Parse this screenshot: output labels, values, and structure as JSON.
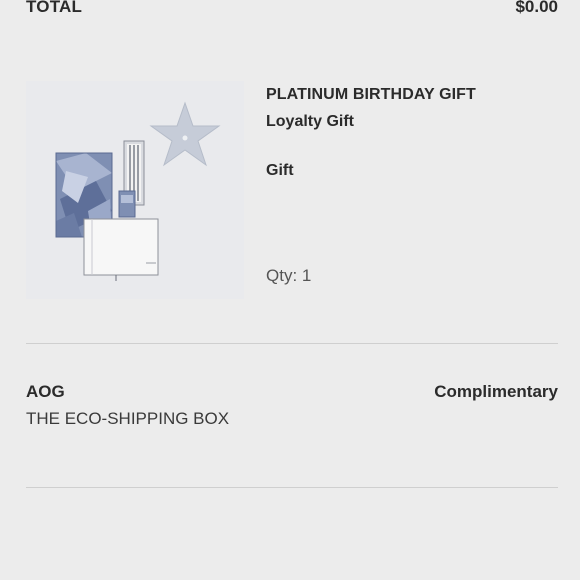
{
  "summary": {
    "total_label": "TOTAL",
    "total_value": "$0.00"
  },
  "product": {
    "title": "PLATINUM BIRTHDAY GIFT",
    "subtitle": "Loyalty Gift",
    "type": "Gift",
    "quantity": "Qty: 1",
    "image_icon": "gift-set-image"
  },
  "shipping": {
    "label": "AOG",
    "description": "THE ECO-SHIPPING BOX",
    "price": "Complimentary"
  },
  "colors": {
    "background": "#ececec",
    "text": "#2b2b2b",
    "divider": "#cfcfcf"
  }
}
